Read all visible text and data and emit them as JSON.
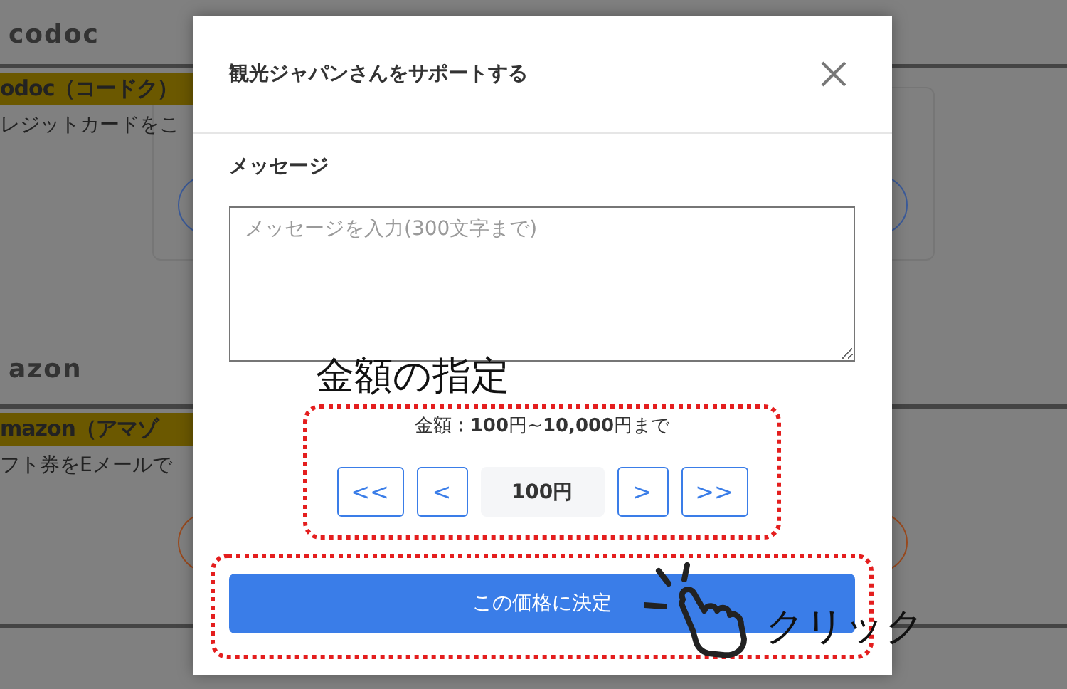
{
  "background_page": {
    "sections": [
      {
        "logo": "codoc",
        "heading": "odoc（コードク）",
        "description": "レジットカードをこ",
        "kind": "card"
      },
      {
        "logo": "azon",
        "heading": "mazon（アマゾ",
        "description": "フト券をEメールで",
        "kind": "plain"
      }
    ]
  },
  "dialog": {
    "title": "観光ジャパンさんをサポートする",
    "message_label": "メッセージ",
    "message_field": {
      "placeholder": "メッセージを入力(300文字まで)"
    },
    "amount_range": "金額**：100**円~**10,000**円まで",
    "stepper": {
      "buttons_before": [
        "<<",
        "<"
      ],
      "value": "100円",
      "buttons_after": [
        ">",
        ">>"
      ]
    },
    "submit_button": "この価格に決定"
  },
  "annotations": {
    "callout_title": "金額の指定",
    "click_label": "クリック"
  }
}
